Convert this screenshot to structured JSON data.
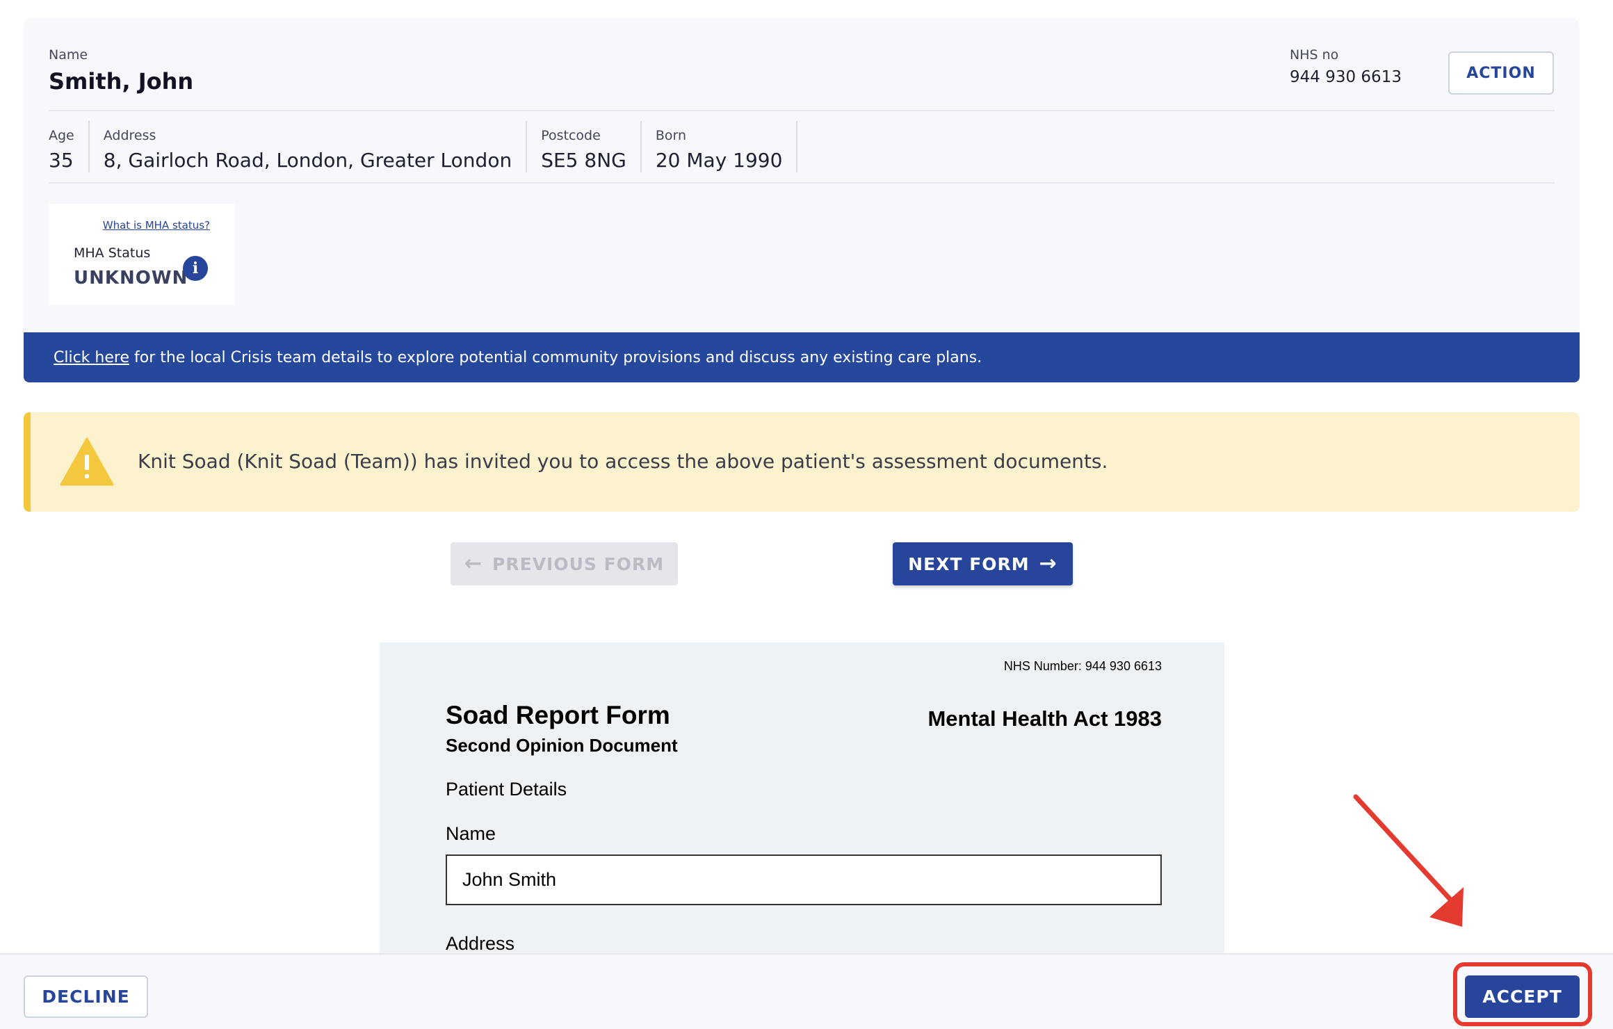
{
  "patient": {
    "name_label": "Name",
    "name": "Smith, John",
    "nhs_label": "NHS no",
    "nhs_number": "944 930 6613",
    "action_label": "ACTION",
    "age_label": "Age",
    "age": "35",
    "address_label": "Address",
    "address": "8, Gairloch Road, London, Greater London",
    "postcode_label": "Postcode",
    "postcode": "SE5 8NG",
    "born_label": "Born",
    "born": "20 May 1990",
    "mha_link": "What is MHA status?",
    "mha_label": "MHA Status",
    "mha_value": "UNKNOWN",
    "info_glyph": "i"
  },
  "crisis": {
    "link_text": "Click here",
    "text": "for the local Crisis team details to explore potential community provisions and discuss any existing care plans."
  },
  "warning": {
    "icon": "warning-triangle-icon",
    "text": "Knit Soad (Knit Soad (Team)) has invited you to access the above patient's assessment documents."
  },
  "nav": {
    "prev_label": "PREVIOUS FORM",
    "prev_arrow": "←",
    "next_label": "NEXT FORM",
    "next_arrow": "→"
  },
  "document": {
    "nhs_line": "NHS Number: 944 930 6613",
    "title": "Soad Report Form",
    "subtitle": "Second Opinion Document",
    "act": "Mental Health Act 1983",
    "section": "Patient Details",
    "name_label": "Name",
    "name_value": "John Smith",
    "address_label": "Address"
  },
  "footer": {
    "decline_label": "DECLINE",
    "accept_label": "ACCEPT"
  },
  "colors": {
    "primary": "#27459a",
    "banner": "#26489c",
    "warning_bg": "#fcf2cd",
    "warning_accent": "#f4c83e",
    "annotation": "#e53a2f"
  }
}
